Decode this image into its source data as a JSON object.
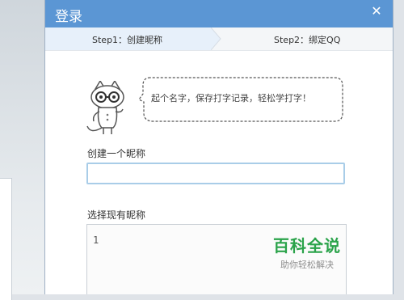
{
  "dialog": {
    "title": "登录",
    "close_glyph": "✕"
  },
  "steps": [
    {
      "label": "Step1：创建昵称"
    },
    {
      "label": "Step2：绑定QQ"
    }
  ],
  "bubble": {
    "text": "起个名字，保存打字记录，轻松学打字！"
  },
  "form": {
    "create_label": "创建一个昵称",
    "create_value": "",
    "choose_label": "选择现有昵称",
    "choose_line_number": "1"
  },
  "watermark": {
    "brand": "百科全说",
    "slogan": "助你轻松解决"
  }
}
